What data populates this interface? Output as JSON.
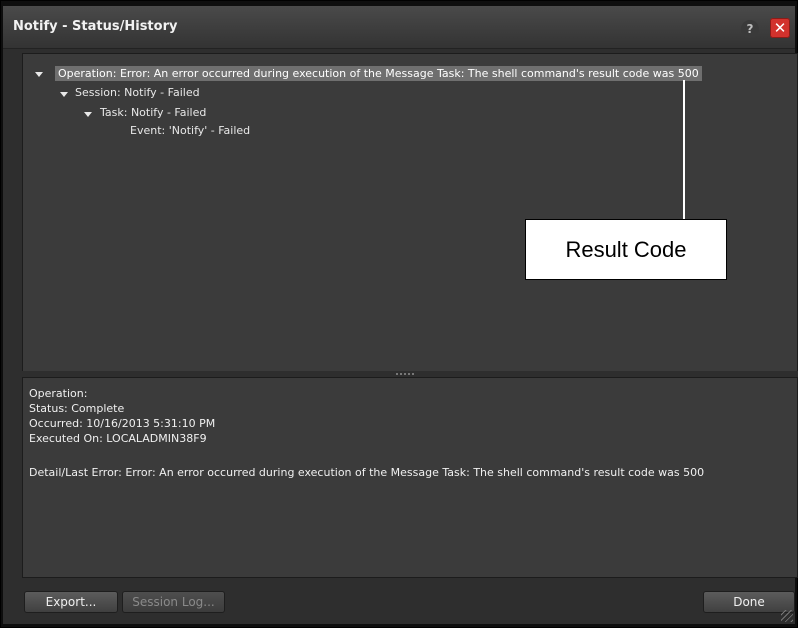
{
  "window": {
    "title": "Notify - Status/History",
    "help_icon": "?",
    "close_icon": "✕"
  },
  "tree": {
    "operation": "Operation: Error: An error occurred during execution of the Message Task: The shell command's result code was 500",
    "session": "Session: Notify - Failed",
    "task": "Task: Notify - Failed",
    "event": "Event: 'Notify' - Failed"
  },
  "details": {
    "operation": "Operation:",
    "status": "Status: Complete",
    "occurred": "Occurred: 10/16/2013 5:31:10 PM",
    "executed_on": "Executed On: LOCALADMIN38F9",
    "detail": "Detail/Last Error: Error: An error occurred during execution of the Message Task: The shell command's result code was 500"
  },
  "buttons": {
    "export": "Export...",
    "session_log": "Session Log...",
    "done": "Done"
  },
  "callout": {
    "label": "Result Code"
  },
  "colors": {
    "panel": "#3b3b3b",
    "background": "#2e2e2e",
    "close": "#d2322d"
  }
}
